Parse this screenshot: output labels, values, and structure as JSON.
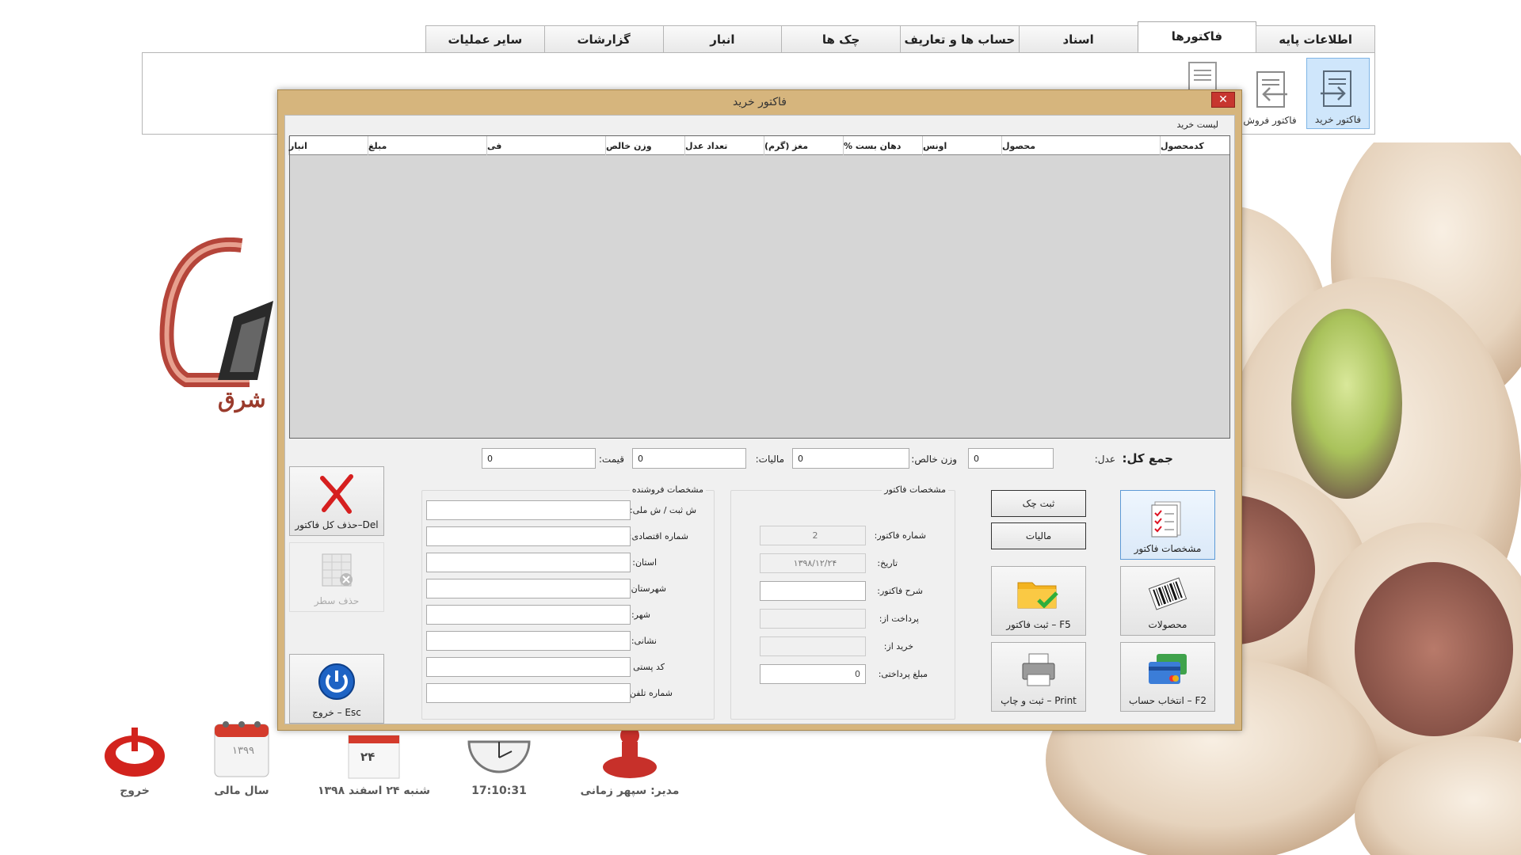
{
  "tabs": [
    {
      "label": "اطلاعات پایه",
      "active": false
    },
    {
      "label": "فاکتورها",
      "active": true
    },
    {
      "label": "اسناد",
      "active": false
    },
    {
      "label": "حساب ها و تعاریف",
      "active": false
    },
    {
      "label": "چک ها",
      "active": false
    },
    {
      "label": "انبار",
      "active": false
    },
    {
      "label": "گزارشات",
      "active": false
    },
    {
      "label": "سایر عملیات",
      "active": false
    }
  ],
  "ribbon": {
    "purchase_invoice": "فاکتور خرید",
    "sales_invoice": "فاکتور فروش"
  },
  "logo": {
    "text": "شرق"
  },
  "status_bar": {
    "manager": "مدیر: سپهر زمانی",
    "time": "17:10:31",
    "date": "شنبه ۲۴ اسفند ۱۳۹۸",
    "date_day": "۲۴",
    "fiscal_year": "سال مالی",
    "fiscal_year_value": "۱۳۹۹",
    "exit": "خروج"
  },
  "dialog": {
    "title": "فاکتور خرید",
    "close_icon": "close-icon",
    "list_label": "لیست خرید",
    "columns": [
      "کدمحصول",
      "محصول",
      "اونس",
      "دهان بست %",
      "مغز (گرم)",
      "تعداد عدل",
      "وزن خالص",
      "فی",
      "مبلغ",
      "انبار"
    ],
    "totals": {
      "sum_label": "جمع کل:",
      "bales_label": "عدل:",
      "bales_value": "0",
      "net_weight_label": "وزن خالص:",
      "net_weight_value": "0",
      "tax_label": "مالیات:",
      "tax_value": "0",
      "price_label": "قیمت:",
      "price_value": "0"
    },
    "invoice_panel": {
      "title": "مشخصات فاکتور",
      "number_label": "شماره فاکتور:",
      "number_value": "2",
      "date_label": "تاریخ:",
      "date_value": "۱۳۹۸/۱۲/۲۴",
      "desc_label": "شرح فاکتور:",
      "desc_value": "",
      "paid_from_label": "پرداخت از:",
      "paid_from_value": "",
      "bought_from_label": "خرید از:",
      "bought_from_value": "",
      "paid_amount_label": "مبلغ پرداختی:",
      "paid_amount_value": "0"
    },
    "seller_panel": {
      "title": "مشخصات فروشنده",
      "fields": [
        {
          "label": "ش ثبت / ش ملی:",
          "value": ""
        },
        {
          "label": "شماره اقتصادی:",
          "value": ""
        },
        {
          "label": "استان:",
          "value": ""
        },
        {
          "label": "شهرستان:",
          "value": ""
        },
        {
          "label": "شهر:",
          "value": ""
        },
        {
          "label": "نشانی:",
          "value": ""
        },
        {
          "label": "کد پستی :",
          "value": ""
        },
        {
          "label": "شماره تلفن:",
          "value": ""
        }
      ]
    },
    "buttons": {
      "invoice_details": "مشخصات فاکتور",
      "register_check": "ثبت چک",
      "tax": "مالیات",
      "products": "محصولات",
      "register_invoice": "F5 – ثبت فاکتور",
      "select_account": "F2 – انتخاب حساب",
      "print": "Print – ثبت و چاپ",
      "delete_all": "Del–حذف کل فاکتور",
      "delete_row": "حذف سطر",
      "exit": "Esc – خروج"
    }
  }
}
